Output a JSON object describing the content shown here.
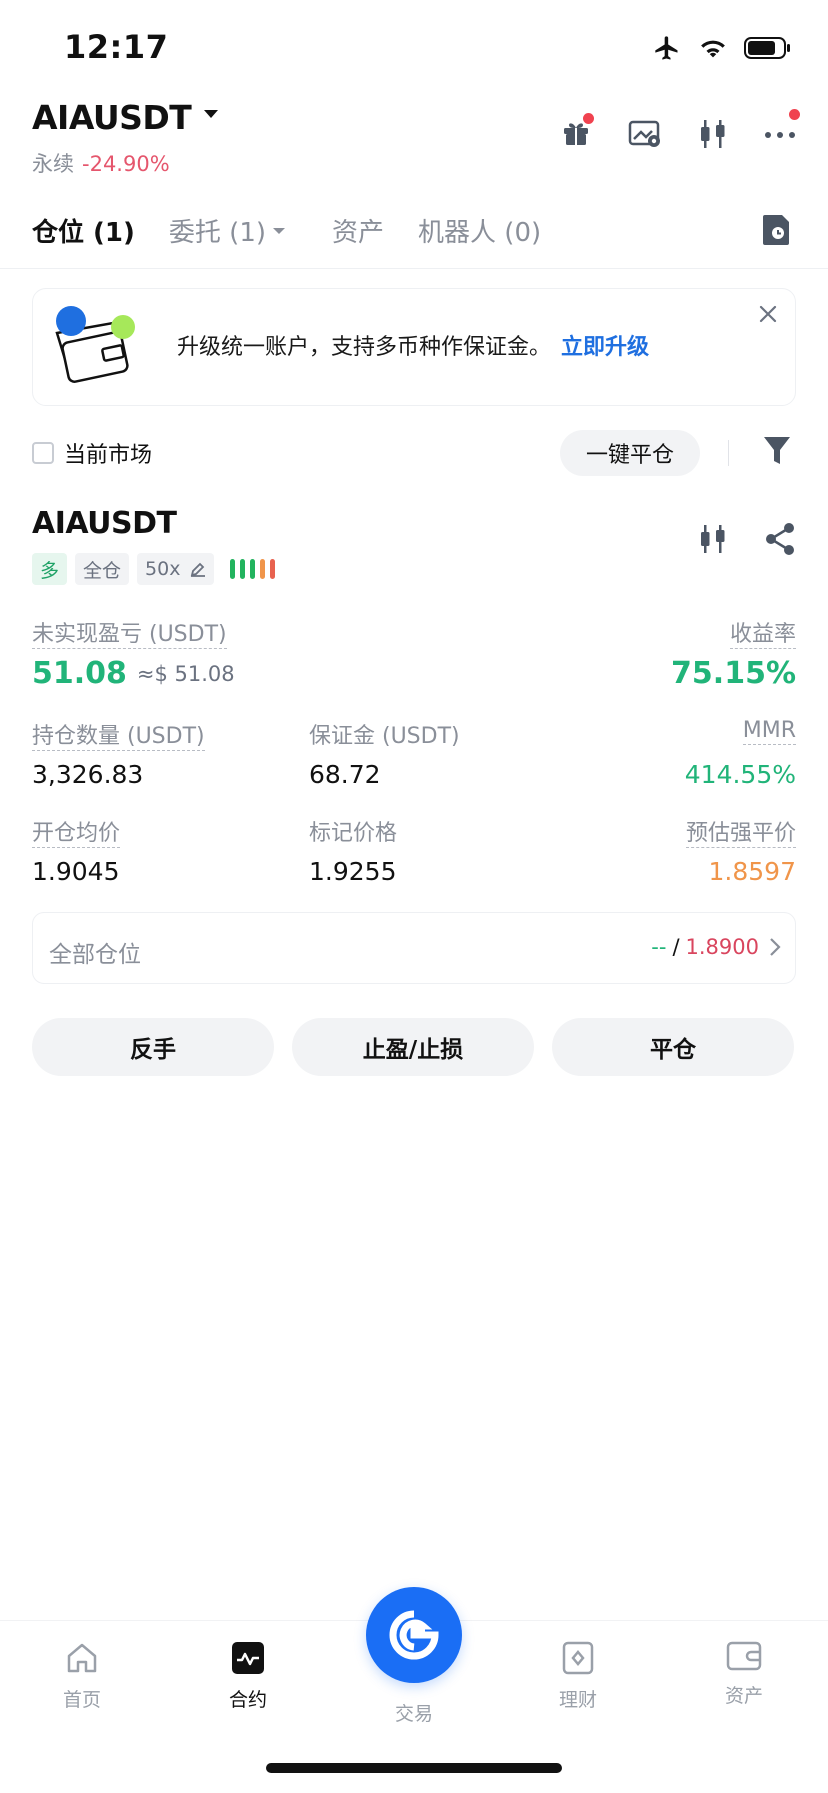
{
  "status_bar": {
    "time": "12:17"
  },
  "header": {
    "symbol": "AIAUSDT",
    "contract_type": "永续",
    "change_pct": "-24.90%"
  },
  "tabs": [
    {
      "label": "仓位 (1)",
      "active": true
    },
    {
      "label": "委托 (1)",
      "has_dropdown": true
    },
    {
      "label": "资产"
    },
    {
      "label": "机器人 (0)"
    }
  ],
  "banner": {
    "text": "升级统一账户，支持多币种作保证金。",
    "link": "立即升级"
  },
  "filter": {
    "current_market_label": "当前市场",
    "close_all_label": "一键平仓"
  },
  "position": {
    "symbol": "AIAUSDT",
    "side": "多",
    "margin_mode": "全仓",
    "leverage": "50x",
    "unrealized_pnl_label": "未实现盈亏 (USDT)",
    "unrealized_pnl": "51.08",
    "unrealized_pnl_usd": "≈$ 51.08",
    "roe_label": "收益率",
    "roe": "75.15%",
    "size_label": "持仓数量 (USDT)",
    "size": "3,326.83",
    "margin_label": "保证金 (USDT)",
    "margin": "68.72",
    "mmr_label": "MMR",
    "mmr": "414.55%",
    "entry_label": "开仓均价",
    "entry_price": "1.9045",
    "mark_label": "标记价格",
    "mark_price": "1.9255",
    "liq_label": "预估强平价",
    "liq_price": "1.8597",
    "risk_bar_colors": [
      "#22b35e",
      "#22b35e",
      "#22b35e",
      "#f0954a",
      "#e8624f"
    ]
  },
  "all_positions": {
    "label": "全部仓位",
    "tp": "--",
    "sl": "1.8900"
  },
  "actions": {
    "reverse": "反手",
    "tpsl": "止盈/止损",
    "close": "平仓"
  },
  "bottom_nav": {
    "home": "首页",
    "futures": "合约",
    "trade": "交易",
    "finance": "理财",
    "assets": "资产"
  },
  "colors": {
    "accent_blue": "#1a6ef5",
    "profit_green": "#21b479",
    "loss_red": "#e5566d"
  }
}
